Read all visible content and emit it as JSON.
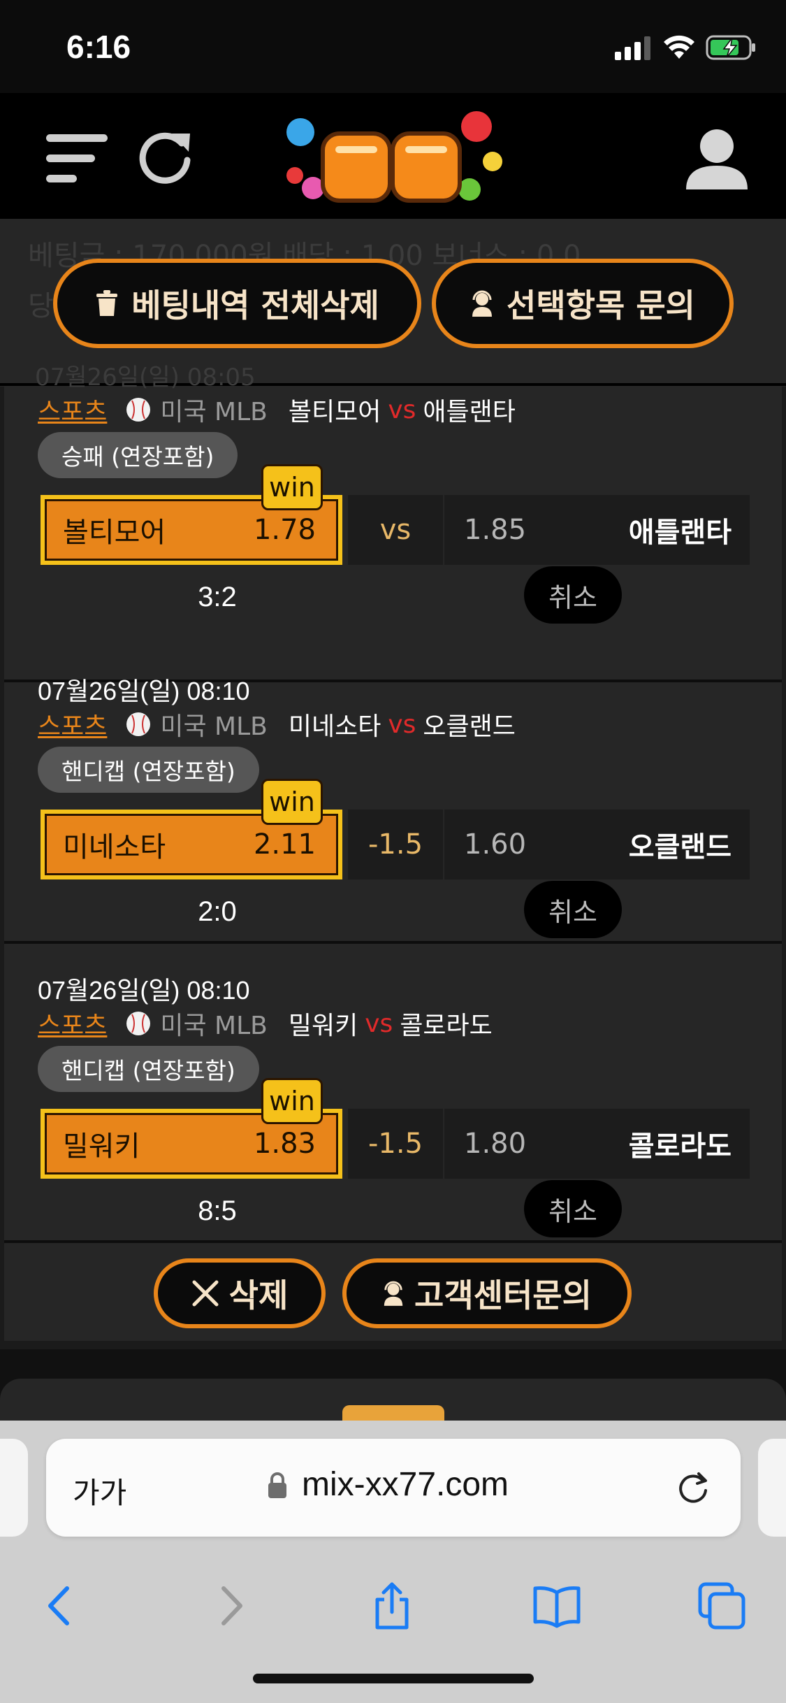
{
  "status": {
    "time": "6:16"
  },
  "summary": {
    "line1": "베팅금 : 170,000원    배당 : 1.00    보너스 : 0.0",
    "line2": "당"
  },
  "top_actions": {
    "delete_all": "베팅내역 전체삭제",
    "inquiry": "선택항목 문의"
  },
  "ghost_date": "07월26일(일) 08:05",
  "bets": [
    {
      "date": "",
      "sport": "스포츠",
      "league": "미국 MLB",
      "home": "볼티모어",
      "vs": "vs",
      "away": "애틀랜타",
      "market": "승패 (연장포함)",
      "home_odds": "1.78",
      "mid": "vs",
      "away_odds": "1.85",
      "win_label": "win",
      "score": "3:2",
      "cancel": "취소"
    },
    {
      "date": "07월26일(일) 08:10",
      "sport": "스포츠",
      "league": "미국 MLB",
      "home": "미네소타",
      "vs": "vs",
      "away": "오클랜드",
      "market": "핸디캡 (연장포함)",
      "home_odds": "2.11",
      "mid": "-1.5",
      "away_odds": "1.60",
      "win_label": "win",
      "score": "2:0",
      "cancel": "취소"
    },
    {
      "date": "07월26일(일) 08:10",
      "sport": "스포츠",
      "league": "미국 MLB",
      "home": "밀워키",
      "vs": "vs",
      "away": "콜로라도",
      "market": "핸디캡 (연장포함)",
      "home_odds": "1.83",
      "mid": "-1.5",
      "away_odds": "1.80",
      "win_label": "win",
      "score": "8:5",
      "cancel": "취소"
    }
  ],
  "bottom_actions": {
    "delete": "삭제",
    "support": "고객센터문의"
  },
  "browser": {
    "aa": "가가",
    "url": "mix-xx77.com"
  },
  "colors": {
    "accent": "#e8851a",
    "win": "#f5c11a",
    "vs": "#e12a2a",
    "panel": "#262626"
  },
  "icons": [
    "menu-icon",
    "refresh-icon",
    "user-icon",
    "trash-icon",
    "headset-icon",
    "baseball-icon",
    "close-icon",
    "lock-icon",
    "reload-icon",
    "back-icon",
    "forward-icon",
    "share-icon",
    "bookmarks-icon",
    "tabs-icon"
  ]
}
